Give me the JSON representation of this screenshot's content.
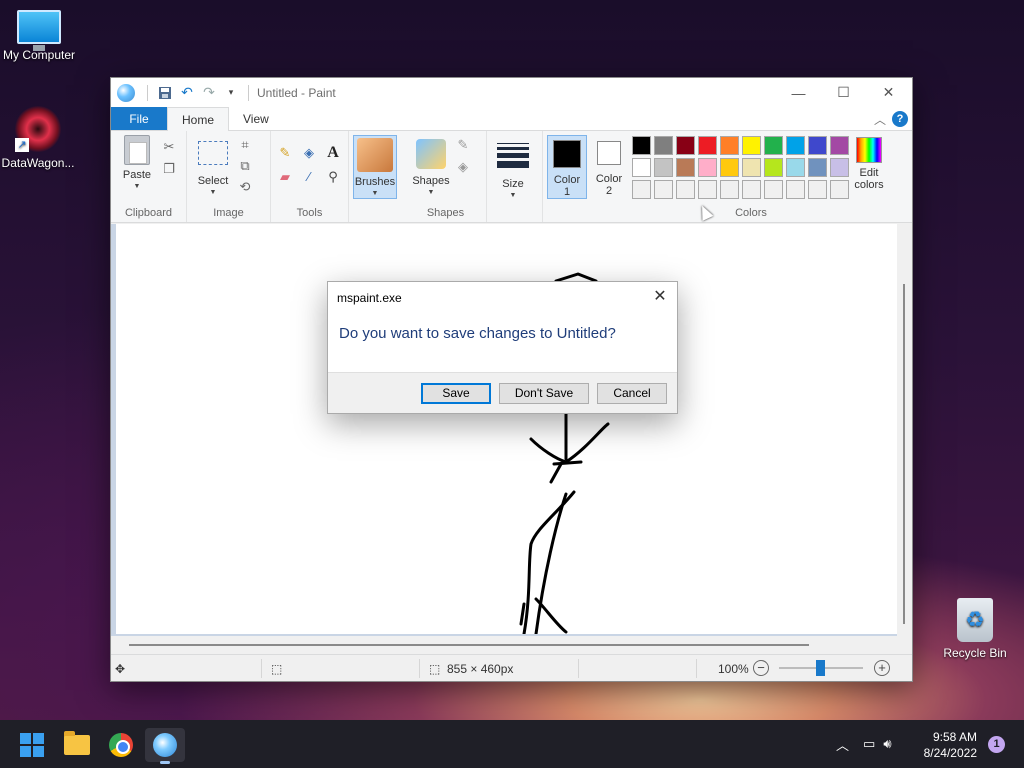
{
  "desktop": {
    "icons": [
      {
        "label": "My Computer"
      },
      {
        "label": "DataWagon..."
      },
      {
        "label": "Recycle Bin"
      }
    ]
  },
  "paint": {
    "title": "Untitled - Paint",
    "menu": {
      "file": "File",
      "home": "Home",
      "view": "View"
    },
    "ribbon": {
      "clipboard": {
        "paste": "Paste",
        "label": "Clipboard"
      },
      "image": {
        "select": "Select",
        "label": "Image"
      },
      "tools": {
        "label": "Tools"
      },
      "brushes": "Brushes",
      "shapes": {
        "shapes": "Shapes",
        "label": "Shapes"
      },
      "size": "Size",
      "color1": {
        "line1": "Color",
        "line2": "1"
      },
      "color2": {
        "line1": "Color",
        "line2": "2"
      },
      "edit_colors": {
        "line1": "Edit",
        "line2": "colors"
      },
      "colors_label": "Colors",
      "color1_value": "#000000",
      "color2_value": "#ffffff",
      "palette": [
        "#000000",
        "#7f7f7f",
        "#880015",
        "#ed1c24",
        "#ff7f27",
        "#fff200",
        "#22b14c",
        "#00a2e8",
        "#3f48cc",
        "#a349a4",
        "#ffffff",
        "#c3c3c3",
        "#b97a57",
        "#ffaec9",
        "#ffc90e",
        "#efe4b0",
        "#b5e61d",
        "#99d9ea",
        "#7092be",
        "#c8bfe7",
        "#f0f0f0",
        "#f0f0f0",
        "#f0f0f0",
        "#f0f0f0",
        "#f0f0f0",
        "#f0f0f0",
        "#f0f0f0",
        "#f0f0f0",
        "#f0f0f0",
        "#f0f0f0"
      ]
    },
    "status": {
      "dimensions": "855 × 460px",
      "zoom": "100%"
    }
  },
  "dialog": {
    "title": "mspaint.exe",
    "message": "Do you want to save changes to Untitled?",
    "save": "Save",
    "dont_save": "Don't Save",
    "cancel": "Cancel"
  },
  "taskbar": {
    "time": "9:58 AM",
    "date": "8/24/2022",
    "notifications": "1"
  }
}
